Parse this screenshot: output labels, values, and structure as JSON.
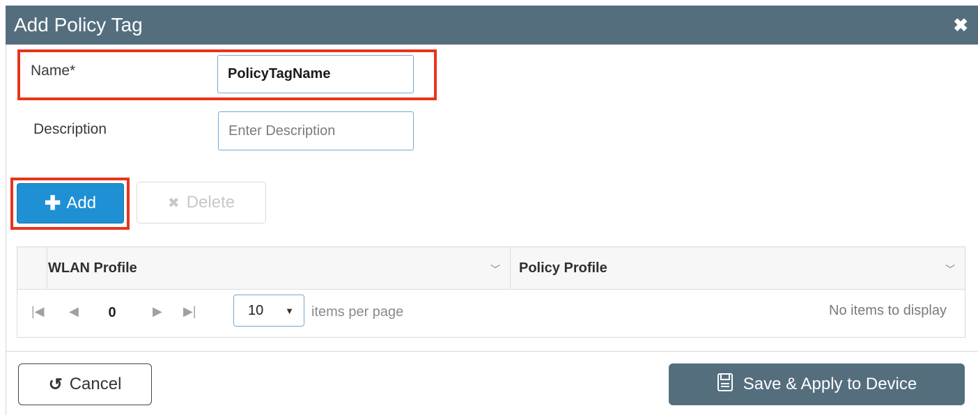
{
  "dialog": {
    "title": "Add Policy Tag",
    "close_icon": "close-icon"
  },
  "form": {
    "name_label": "Name*",
    "name_value": "PolicyTagName",
    "description_label": "Description",
    "description_placeholder": "Enter Description"
  },
  "toolbar": {
    "add_label": "Add",
    "add_icon": "plus-icon",
    "delete_label": "Delete",
    "delete_icon": "close-icon"
  },
  "grid": {
    "columns": [
      "WLAN Profile",
      "Policy Profile"
    ],
    "page_number": "0",
    "page_size": "10",
    "page_size_label": "items per page",
    "empty_message": "No items to display"
  },
  "footer": {
    "cancel_label": "Cancel",
    "cancel_icon": "undo-icon",
    "save_label": "Save & Apply to Device",
    "save_icon": "floppy-disk-icon"
  },
  "colors": {
    "titlebar": "#546e7e",
    "primary_button": "#1f90d4",
    "highlight": "#e8341c",
    "input_border": "#6fa9d3"
  }
}
